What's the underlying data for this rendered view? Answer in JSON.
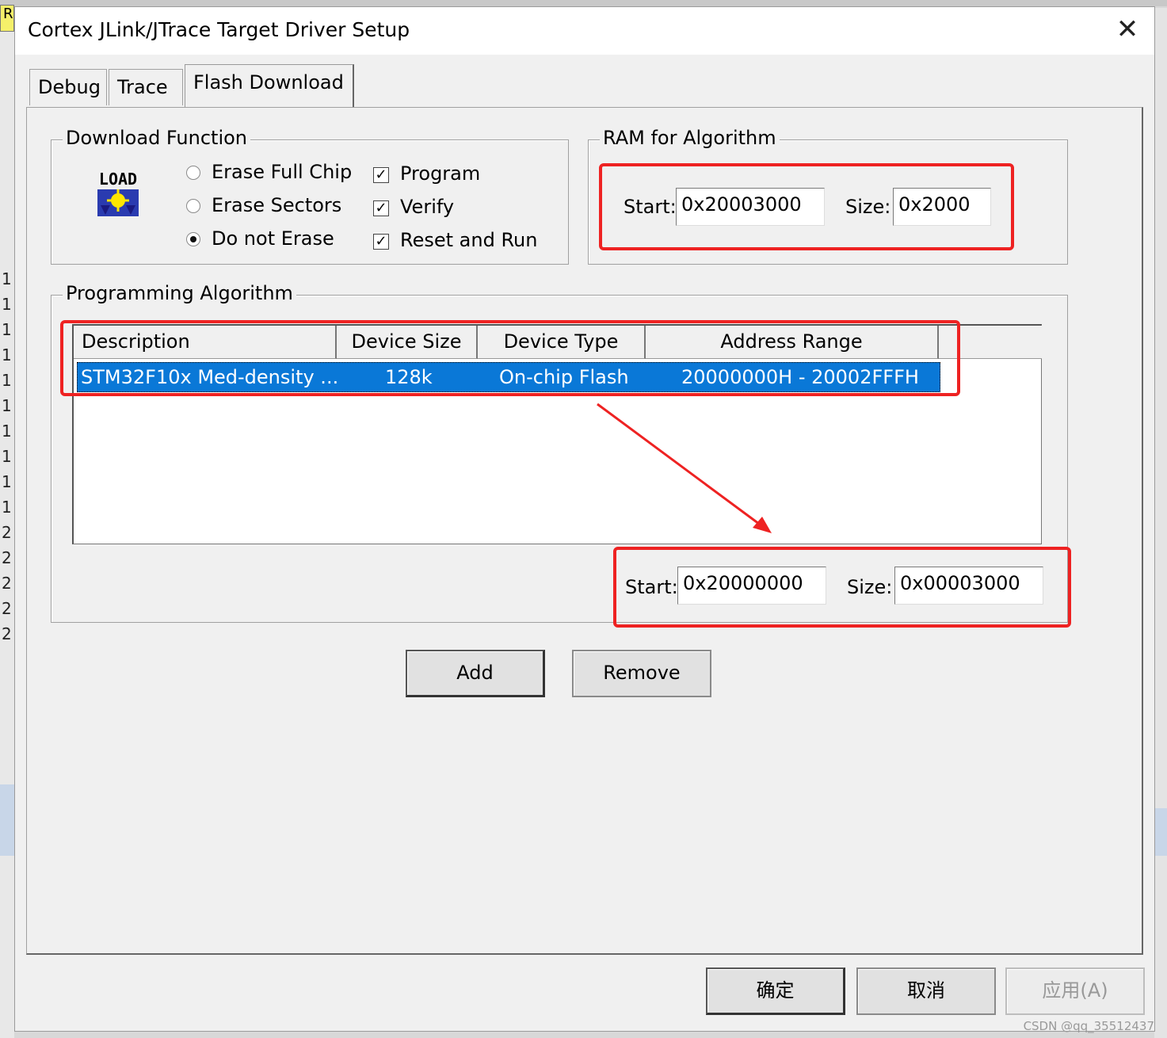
{
  "window": {
    "title": "Cortex JLink/JTrace Target Driver Setup",
    "close_symbol": "✕"
  },
  "tabs": [
    {
      "label": "Debug"
    },
    {
      "label": "Trace"
    },
    {
      "label": "Flash Download",
      "active": true
    }
  ],
  "download_function": {
    "legend": "Download Function",
    "icon": "load-icon",
    "icon_text": "LOAD",
    "radios": [
      {
        "label": "Erase Full Chip",
        "checked": false
      },
      {
        "label": "Erase Sectors",
        "checked": false
      },
      {
        "label": "Do not Erase",
        "checked": true
      }
    ],
    "checkboxes": [
      {
        "label": "Program",
        "checked": true
      },
      {
        "label": "Verify",
        "checked": true
      },
      {
        "label": "Reset and Run",
        "checked": true
      }
    ]
  },
  "ram_for_algorithm": {
    "legend": "RAM for Algorithm",
    "start_label": "Start:",
    "start_value": "0x20003000",
    "size_label": "Size:",
    "size_value": "0x2000"
  },
  "programming_algorithm": {
    "legend": "Programming Algorithm",
    "columns": [
      "Description",
      "Device Size",
      "Device Type",
      "Address Range"
    ],
    "rows": [
      {
        "description": "STM32F10x Med-density ...",
        "device_size": "128k",
        "device_type": "On-chip Flash",
        "address_range": "20000000H - 20002FFFH",
        "selected": true
      }
    ],
    "start_label": "Start:",
    "start_value": "0x20000000",
    "size_label": "Size:",
    "size_value": "0x00003000",
    "add_label": "Add",
    "remove_label": "Remove"
  },
  "footer": {
    "ok_label": "确定",
    "cancel_label": "取消",
    "apply_label": "应用(A)"
  },
  "background": {
    "line_numbers": [
      "1",
      "1",
      "1",
      "1",
      "1",
      "1",
      "1",
      "1",
      "1",
      "1",
      "2",
      "2",
      "2",
      "2",
      "2"
    ],
    "corner_letter": "R"
  },
  "watermark": "CSDN @qq_35512437",
  "colors": {
    "selection": "#0a78d7",
    "annotation_red": "#ee2222",
    "dialog_bg": "#f0f0f0"
  }
}
